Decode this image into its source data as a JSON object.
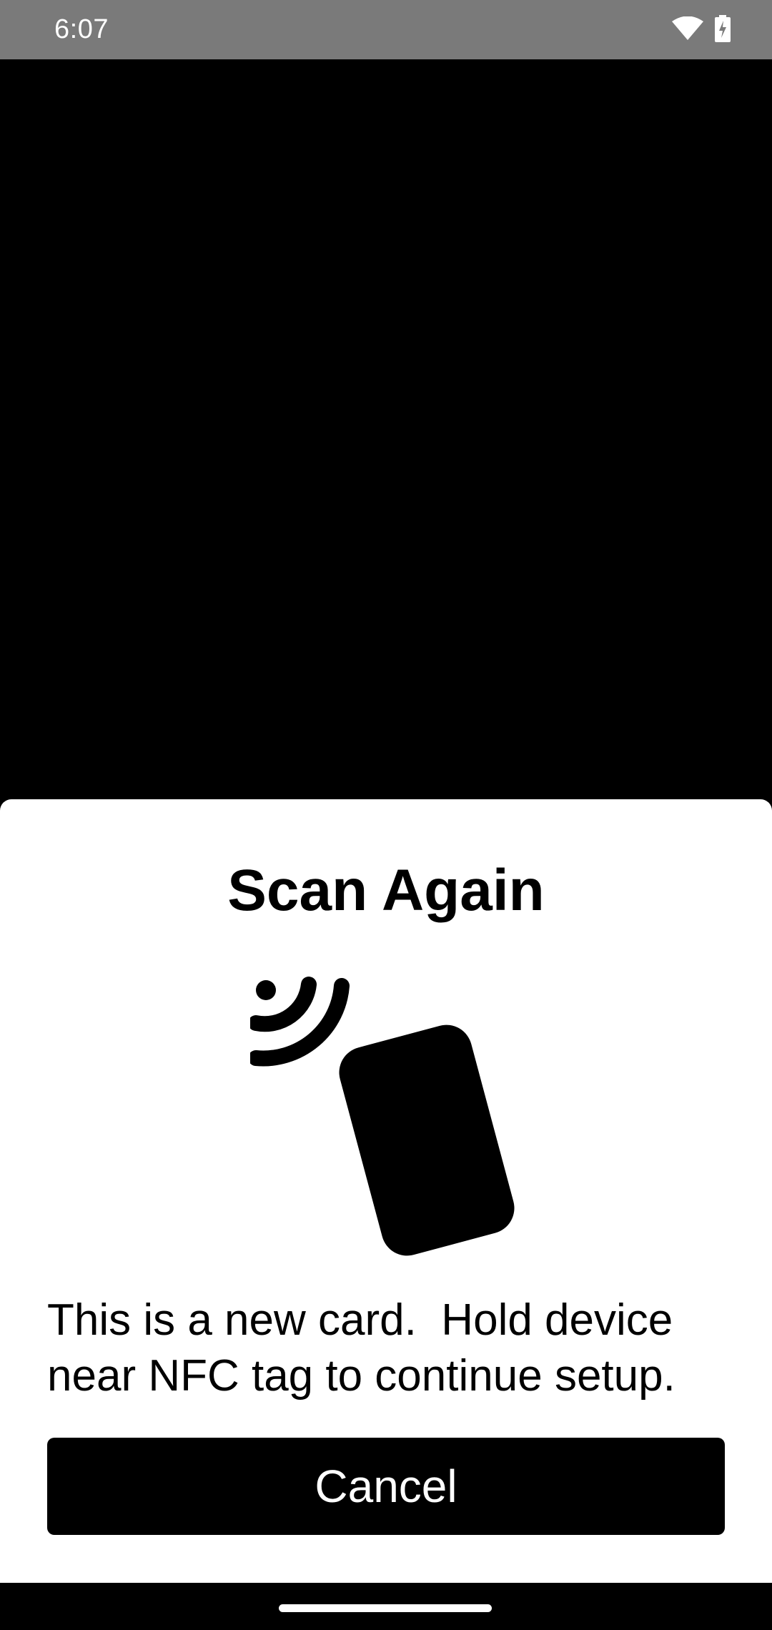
{
  "status_bar": {
    "time": "6:07",
    "icons": [
      "wifi-icon",
      "battery-charging-icon"
    ]
  },
  "sheet": {
    "title": "Scan Again",
    "illustration": "nfc-card-icon",
    "message": "This is a new card.  Hold device\nnear NFC tag to continue setup.",
    "cancel_label": "Cancel"
  },
  "colors": {
    "status_bar_bg": "#7a7a7a",
    "background": "#000000",
    "sheet_bg": "#ffffff",
    "button_bg": "#000000",
    "button_text": "#ffffff"
  }
}
